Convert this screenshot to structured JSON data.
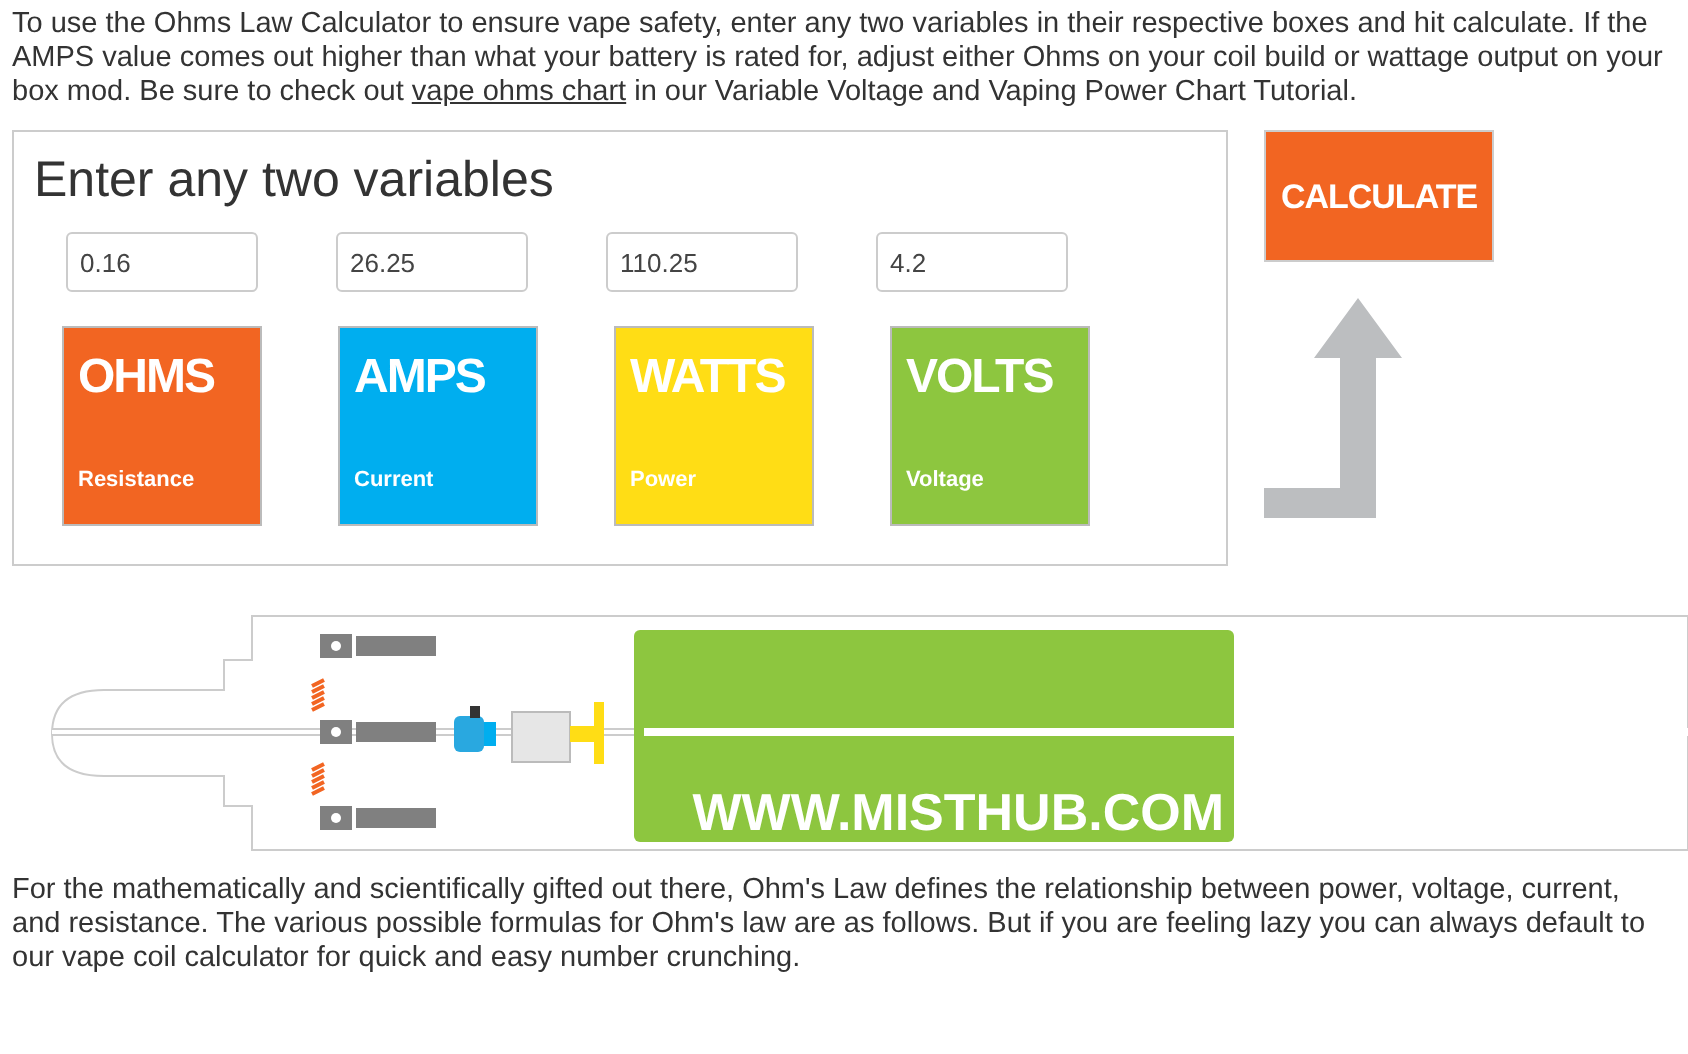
{
  "intro": {
    "before": "To use the Ohms Law Calculator to ensure vape safety, enter any two variables in their respective boxes and hit calculate. If the AMPS value comes out higher than what your battery is rated for, adjust either Ohms on your coil build or wattage output on your box mod. Be sure to check out ",
    "link": "vape ohms chart",
    "after": " in our Variable Voltage and Vaping Power Chart Tutorial."
  },
  "calculator": {
    "heading": "Enter any two variables",
    "fields": [
      {
        "value": "0.16",
        "title": "OHMS",
        "subtitle": "Resistance",
        "color": "#f26522"
      },
      {
        "value": "26.25",
        "title": "AMPS",
        "subtitle": "Current",
        "color": "#00aeef"
      },
      {
        "value": "110.25",
        "title": "WATTS",
        "subtitle": "Power",
        "color": "#ffdd15"
      },
      {
        "value": "4.2",
        "title": "VOLTS",
        "subtitle": "Voltage",
        "color": "#8dc63f"
      }
    ]
  },
  "calculate_button": "CALCULATE",
  "diagram": {
    "url": "WWW.MISTHUB.COM"
  },
  "outro": "For the mathematically and scientifically gifted out there, Ohm's Law defines the relationship between power, voltage, current, and resistance. The various possible formulas for Ohm's law are as follows. But if you are feeling lazy you can always default to our vape coil calculator for quick and easy number crunching."
}
